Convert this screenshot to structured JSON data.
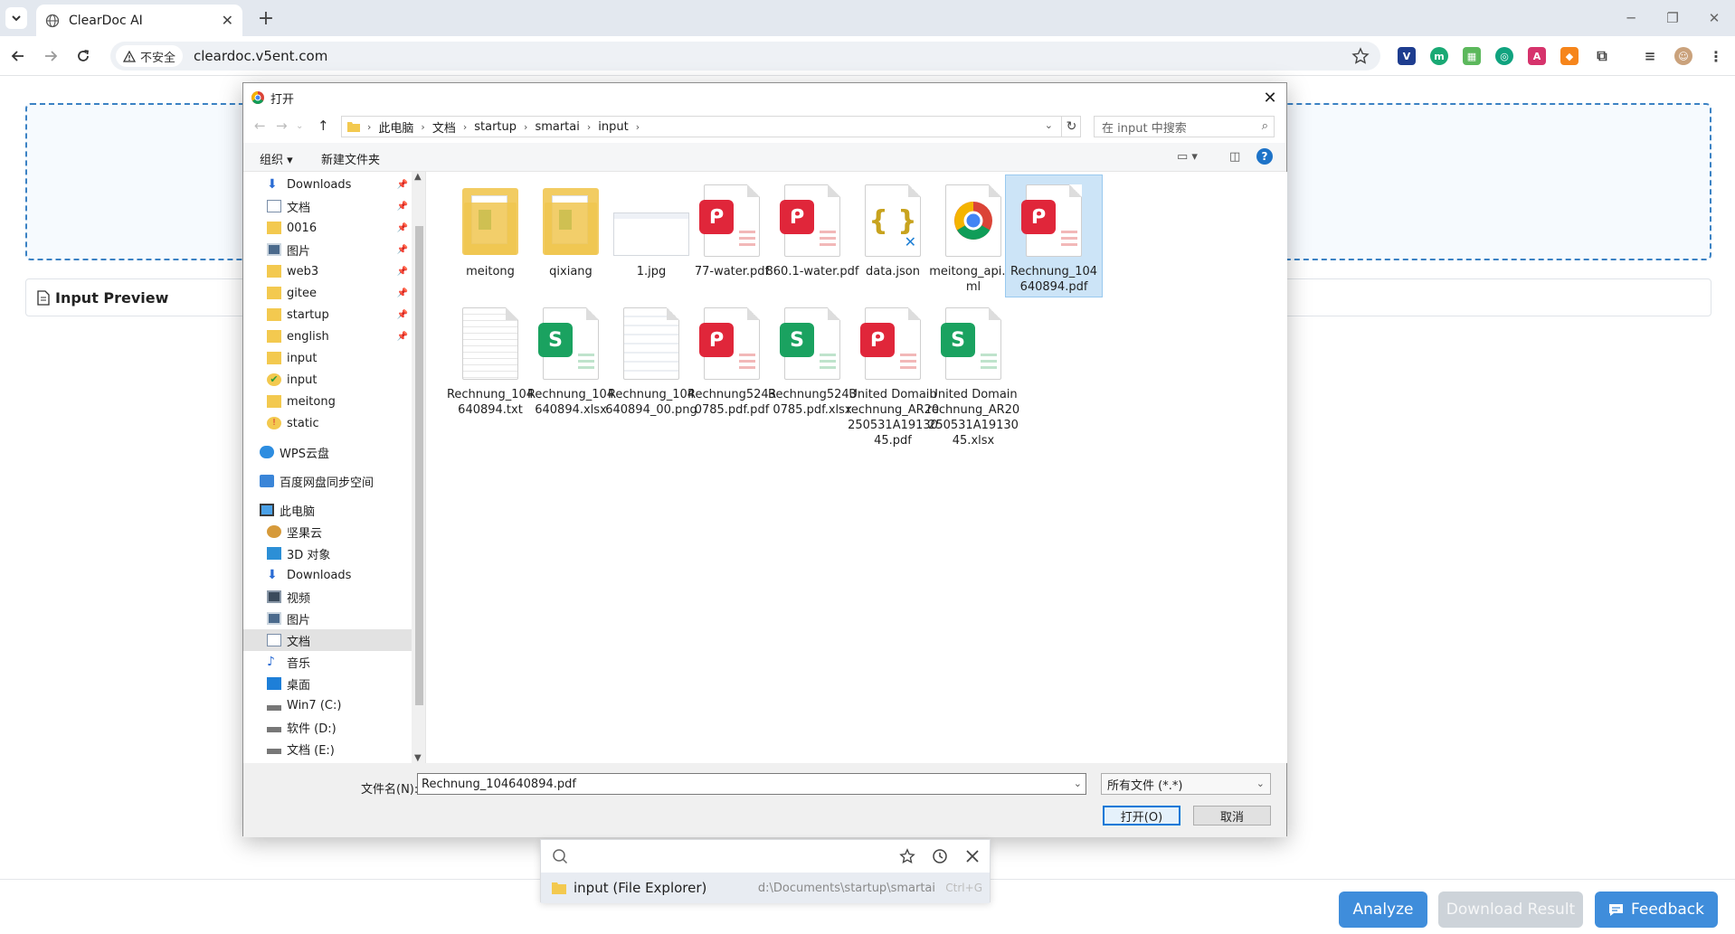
{
  "browser": {
    "tab_title": "ClearDoc AI",
    "security_label": "不安全",
    "url": "cleardoc.v5ent.com"
  },
  "page": {
    "preview_title": "Input Preview",
    "buttons": {
      "analyze": "Analyze",
      "download": "Download Result",
      "feedback": "Feedback"
    }
  },
  "dialog": {
    "title": "打开",
    "breadcrumb": [
      "此电脑",
      "文档",
      "startup",
      "smartai",
      "input"
    ],
    "search_placeholder": "在 input 中搜索",
    "organize": "组织 ▾",
    "new_folder": "新建文件夹",
    "nav_items": [
      {
        "label": "Downloads",
        "icon": "download-arrow-icon",
        "pinned": true
      },
      {
        "label": "文档",
        "icon": "documents-icon",
        "pinned": true
      },
      {
        "label": "0016",
        "icon": "folder-icon",
        "pinned": true
      },
      {
        "label": "图片",
        "icon": "pictures-icon",
        "pinned": true
      },
      {
        "label": "web3",
        "icon": "folder-icon",
        "pinned": true
      },
      {
        "label": "gitee",
        "icon": "folder-icon",
        "pinned": true
      },
      {
        "label": "startup",
        "icon": "folder-icon",
        "pinned": true
      },
      {
        "label": "english",
        "icon": "folder-icon",
        "pinned": true
      },
      {
        "label": "input",
        "icon": "folder-icon",
        "pinned": false
      },
      {
        "label": "input",
        "icon": "green-check-icon",
        "pinned": false
      },
      {
        "label": "meitong",
        "icon": "folder-icon",
        "pinned": false
      },
      {
        "label": "static",
        "icon": "red-badge-icon",
        "pinned": false
      },
      {
        "label": "WPS云盘",
        "icon": "cloud-icon",
        "pinned": false
      },
      {
        "label": "百度网盘同步空间",
        "icon": "baidu-sync-icon",
        "pinned": false
      },
      {
        "label": "此电脑",
        "icon": "computer-icon",
        "pinned": false
      },
      {
        "label": "坚果云",
        "icon": "nut-cloud-icon",
        "pinned": false
      },
      {
        "label": "3D 对象",
        "icon": "cube-icon",
        "pinned": false
      },
      {
        "label": "Downloads",
        "icon": "download-arrow-icon",
        "pinned": false
      },
      {
        "label": "视频",
        "icon": "video-icon",
        "pinned": false
      },
      {
        "label": "图片",
        "icon": "pictures-icon",
        "pinned": false
      },
      {
        "label": "文档",
        "icon": "documents-icon",
        "pinned": false,
        "selected": true
      },
      {
        "label": "音乐",
        "icon": "music-icon",
        "pinned": false
      },
      {
        "label": "桌面",
        "icon": "desktop-icon",
        "pinned": false
      },
      {
        "label": "Win7 (C:)",
        "icon": "drive-icon",
        "pinned": false
      },
      {
        "label": "软件 (D:)",
        "icon": "drive-icon",
        "pinned": false
      },
      {
        "label": "文档 (E:)",
        "icon": "drive-icon",
        "pinned": false
      }
    ],
    "files": [
      {
        "name": "meitong",
        "type": "folder"
      },
      {
        "name": "qixiang",
        "type": "folder"
      },
      {
        "name": "1.jpg",
        "type": "image"
      },
      {
        "name": "77-water.pdf",
        "type": "pdf"
      },
      {
        "name": "860.1-water.pdf",
        "type": "pdf"
      },
      {
        "name": "data.json",
        "type": "json"
      },
      {
        "name": "meitong_api.html",
        "type": "chrome"
      },
      {
        "name": "Rechnung_104640894.pdf",
        "type": "pdf",
        "selected": true
      },
      {
        "name": "Rechnung_104640894.txt",
        "type": "txt"
      },
      {
        "name": "Rechnung_104640894.xlsx",
        "type": "xlsx"
      },
      {
        "name": "Rechnung_104640894_00.png",
        "type": "png"
      },
      {
        "name": "Rechnung52430785.pdf.pdf",
        "type": "pdf"
      },
      {
        "name": "Rechnung52430785.pdf.xlsx",
        "type": "xlsx"
      },
      {
        "name": "United Domain rechnung_AR20250531A1913045.pdf",
        "type": "pdf"
      },
      {
        "name": "United Domain rechnung_AR20250531A1913045.xlsx",
        "type": "xlsx"
      }
    ],
    "filename_label": "文件名(N):",
    "filename_value": "Rechnung_104640894.pdf",
    "filetype": "所有文件 (*.*)",
    "open_button": "打开(O)",
    "cancel_button": "取消"
  },
  "autocomplete": {
    "item_title": "input (File Explorer)",
    "item_path": "d:\\Documents\\startup\\smartai",
    "item_shortcut": "Ctrl+G"
  },
  "colors": {
    "accent_blue": "#3b82c4",
    "pdf_red": "#e0263a",
    "sheet_green": "#1aa260",
    "selection": "#cce4f7"
  }
}
